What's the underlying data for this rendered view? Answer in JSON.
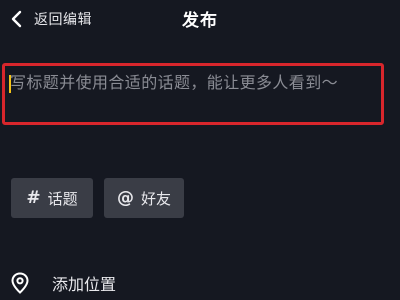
{
  "header": {
    "back_label": "返回编辑",
    "title": "发布"
  },
  "caption": {
    "placeholder": "写标题并使用合适的话题，能让更多人看到～",
    "value": ""
  },
  "chips": {
    "topic": {
      "icon": "#",
      "label": "话题"
    },
    "friend": {
      "icon": "@",
      "label": "好友"
    }
  },
  "location": {
    "label": "添加位置"
  },
  "colors": {
    "background": "#151821",
    "highlight_border": "#d8262c",
    "caret": "#f5c518",
    "chip_background": "#3a3d46",
    "placeholder_text": "#8a8c94"
  },
  "icons": {
    "back": "chevron-left-icon",
    "location": "location-pin-icon"
  }
}
